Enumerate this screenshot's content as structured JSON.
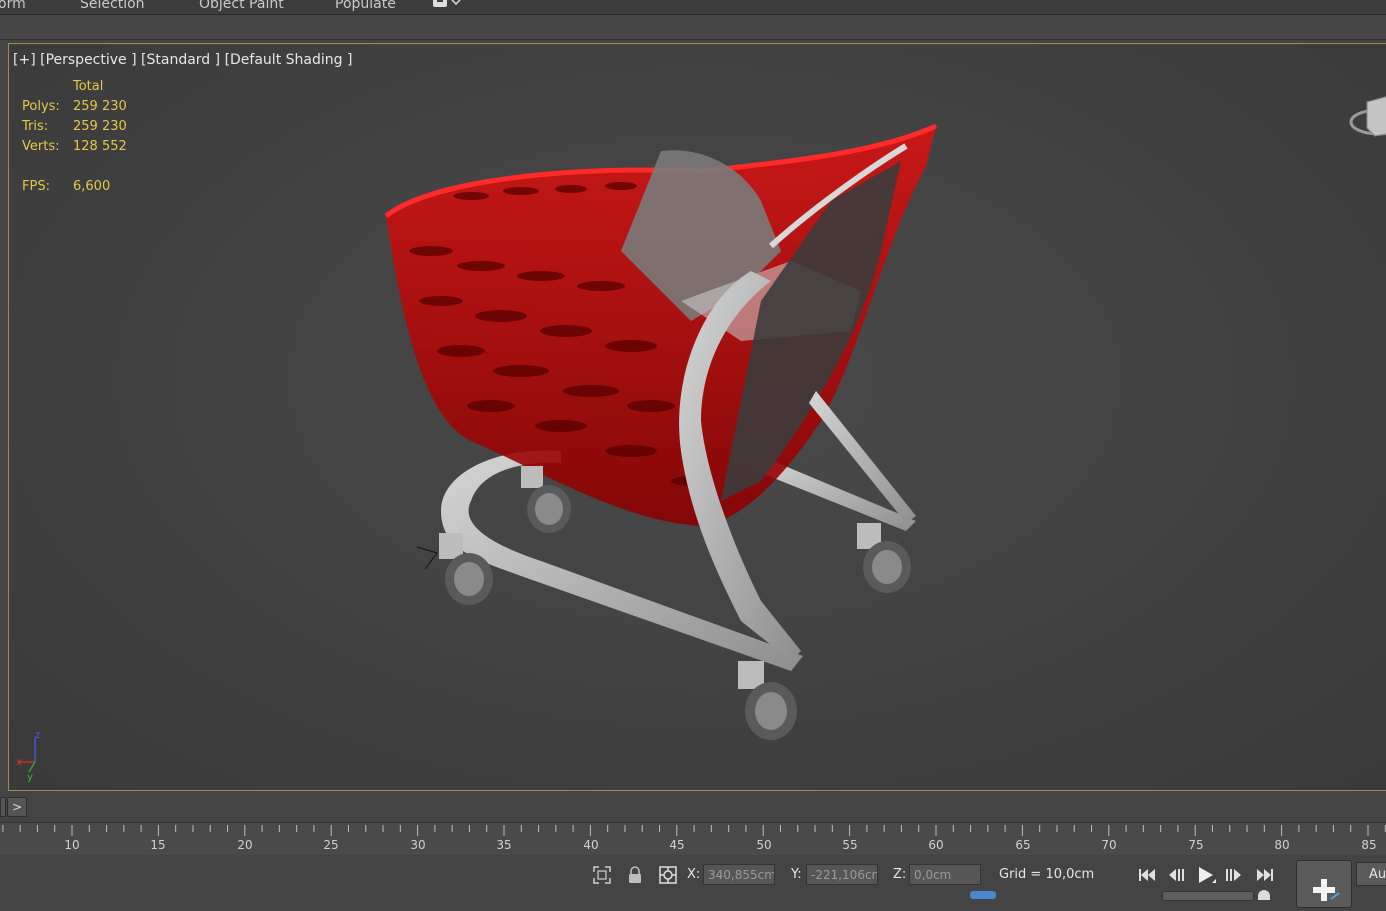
{
  "ribbon": {
    "tabs": [
      "orm",
      "Selection",
      "Object Paint",
      "Populate"
    ]
  },
  "viewport": {
    "label_plus": "[+]",
    "label_view": "[Perspective ]",
    "label_standard": "[Standard ]",
    "label_shading": "[Default Shading ]",
    "stats": {
      "header": "Total",
      "rows": [
        {
          "name": "Polys:",
          "value": "259 230"
        },
        {
          "name": "Tris:",
          "value": "259 230"
        },
        {
          "name": "Verts:",
          "value": "128 552"
        }
      ],
      "fps_name": "FPS:",
      "fps_value": "6,600"
    },
    "axis_labels": {
      "x": "x",
      "y": "y",
      "z": "z"
    }
  },
  "trackbar": {
    "toggle_label": ">"
  },
  "timeline": {
    "ticks": [
      "10",
      "15",
      "20",
      "25",
      "30",
      "35",
      "40",
      "45",
      "50",
      "55",
      "60",
      "65",
      "70",
      "75",
      "80",
      "85"
    ]
  },
  "status": {
    "x_label": "X:",
    "x_value": "340,855cm",
    "y_label": "Y:",
    "y_value": "-221,106cm",
    "z_label": "Z:",
    "z_value": "0,0cm",
    "grid": "Grid = 10,0cm",
    "auto_key": "Au"
  },
  "icons": [
    "selection-lock-icon",
    "lock-icon",
    "absolute-mode-icon",
    "go-to-start-icon",
    "previous-frame-icon",
    "play-icon",
    "next-frame-icon",
    "go-to-end-icon",
    "add-key-icon"
  ],
  "colors": {
    "viewport_border": "#a08c46",
    "stats_text": "#e5c84a",
    "basket_red": "#c40000",
    "frame_gray": "#b8b8b8"
  }
}
